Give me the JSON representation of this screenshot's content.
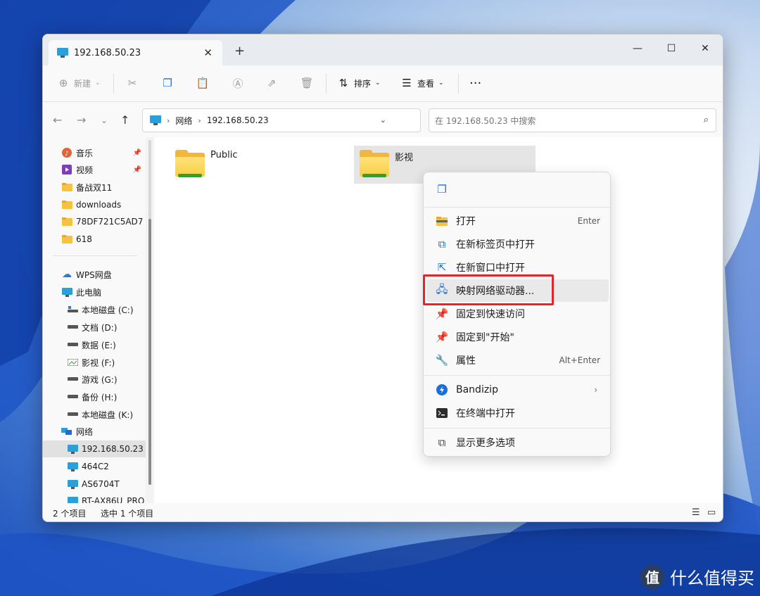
{
  "tab": {
    "title": "192.168.50.23",
    "close": "✕",
    "new_tab": "+"
  },
  "window_controls": {
    "minimize": "—",
    "maximize": "☐",
    "close": "✕"
  },
  "toolbar": {
    "new_label": "新建",
    "sort_label": "排序",
    "view_label": "查看",
    "more": "···"
  },
  "address": {
    "crumbs": [
      "网络",
      "192.168.50.23"
    ],
    "separator": "›",
    "search_placeholder": "在 192.168.50.23 中搜索"
  },
  "sidebar": {
    "quick": [
      {
        "label": "音乐",
        "icon": "music-icon",
        "pinned": true
      },
      {
        "label": "视频",
        "icon": "video-icon",
        "pinned": true
      },
      {
        "label": "备战双11",
        "icon": "folder-icon"
      },
      {
        "label": "downloads",
        "icon": "folder-icon"
      },
      {
        "label": "78DF721C5AD7",
        "icon": "folder-icon"
      },
      {
        "label": "618",
        "icon": "folder-icon"
      }
    ],
    "wps": "WPS网盘",
    "this_pc": "此电脑",
    "drives": [
      {
        "label": "本地磁盘 (C:)"
      },
      {
        "label": "文档 (D:)"
      },
      {
        "label": "数据 (E:)"
      },
      {
        "label": "影视 (F:)"
      },
      {
        "label": "游戏 (G:)"
      },
      {
        "label": "备份 (H:)"
      },
      {
        "label": "本地磁盘 (K:)"
      }
    ],
    "network": "网络",
    "hosts": [
      {
        "label": "192.168.50.23",
        "selected": true
      },
      {
        "label": "464C2"
      },
      {
        "label": "AS6704T"
      },
      {
        "label": "RT-AX86U_PRO"
      }
    ]
  },
  "content": {
    "folders": [
      {
        "name": "Public"
      },
      {
        "name": "影视",
        "selected": true
      }
    ]
  },
  "status": {
    "count": "2 个项目",
    "selected": "选中 1 个项目"
  },
  "context_menu": {
    "items": [
      {
        "label": "打开",
        "shortcut": "Enter",
        "icon": "folder-open-icon"
      },
      {
        "label": "在新标签页中打开",
        "icon": "new-tab-icon"
      },
      {
        "label": "在新窗口中打开",
        "icon": "new-window-icon"
      },
      {
        "label": "映射网络驱动器...",
        "icon": "map-network-drive-icon",
        "highlighted": true
      },
      {
        "label": "固定到快速访问",
        "icon": "pin-icon"
      },
      {
        "label": "固定到\"开始\"",
        "icon": "pin-start-icon"
      },
      {
        "label": "属性",
        "shortcut": "Alt+Enter",
        "icon": "wrench-icon"
      },
      {
        "label": "Bandizip",
        "icon": "bandizip-icon",
        "submenu": true
      },
      {
        "label": "在终端中打开",
        "icon": "terminal-icon"
      },
      {
        "label": "显示更多选项",
        "icon": "more-options-icon"
      }
    ]
  },
  "watermark": {
    "text": "什么值得买",
    "logo": "值"
  },
  "colors": {
    "accent": "#1d6fd8",
    "highlight_box": "#e0262a",
    "folder": "#f0b73a"
  }
}
